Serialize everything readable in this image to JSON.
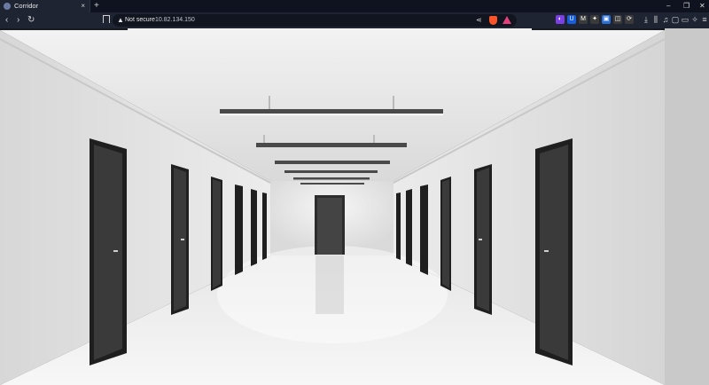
{
  "tab": {
    "title": "Corridor",
    "close": "×"
  },
  "new_tab": "+",
  "window_controls": {
    "minimize": "–",
    "maximize": "❐",
    "close": "✕"
  },
  "nav": {
    "back": "‹",
    "forward": "›",
    "reload": "↻"
  },
  "address": {
    "security_label": "Not secure",
    "url": "10.82.134.150",
    "warning": "▲"
  },
  "extensions": [
    {
      "name": "dark-reader",
      "glyph": "◐",
      "color": "#7b3fe4"
    },
    {
      "name": "bitwarden",
      "glyph": "U",
      "color": "#175ddc"
    },
    {
      "name": "gmail",
      "glyph": "M",
      "color": "#3a3a3a"
    },
    {
      "name": "puzzle",
      "glyph": "✦",
      "color": "#3a3a3a"
    },
    {
      "name": "wallet",
      "glyph": "▣",
      "color": "#2a6fd6"
    },
    {
      "name": "chat",
      "glyph": "◫",
      "color": "#3a3a3a"
    },
    {
      "name": "sync",
      "glyph": "⟳",
      "color": "#3a3a3a"
    }
  ],
  "toolbar_right": [
    "download",
    "library",
    "music",
    "page",
    "reader",
    "ai",
    "menu"
  ],
  "colors": {
    "tabbar": "#0f1320",
    "toolbar": "#1f2433",
    "wall": "#e4e4e4",
    "door": "#3a3a3a",
    "floor": "#f0f0f0"
  },
  "image": {
    "title": "Corridor"
  }
}
